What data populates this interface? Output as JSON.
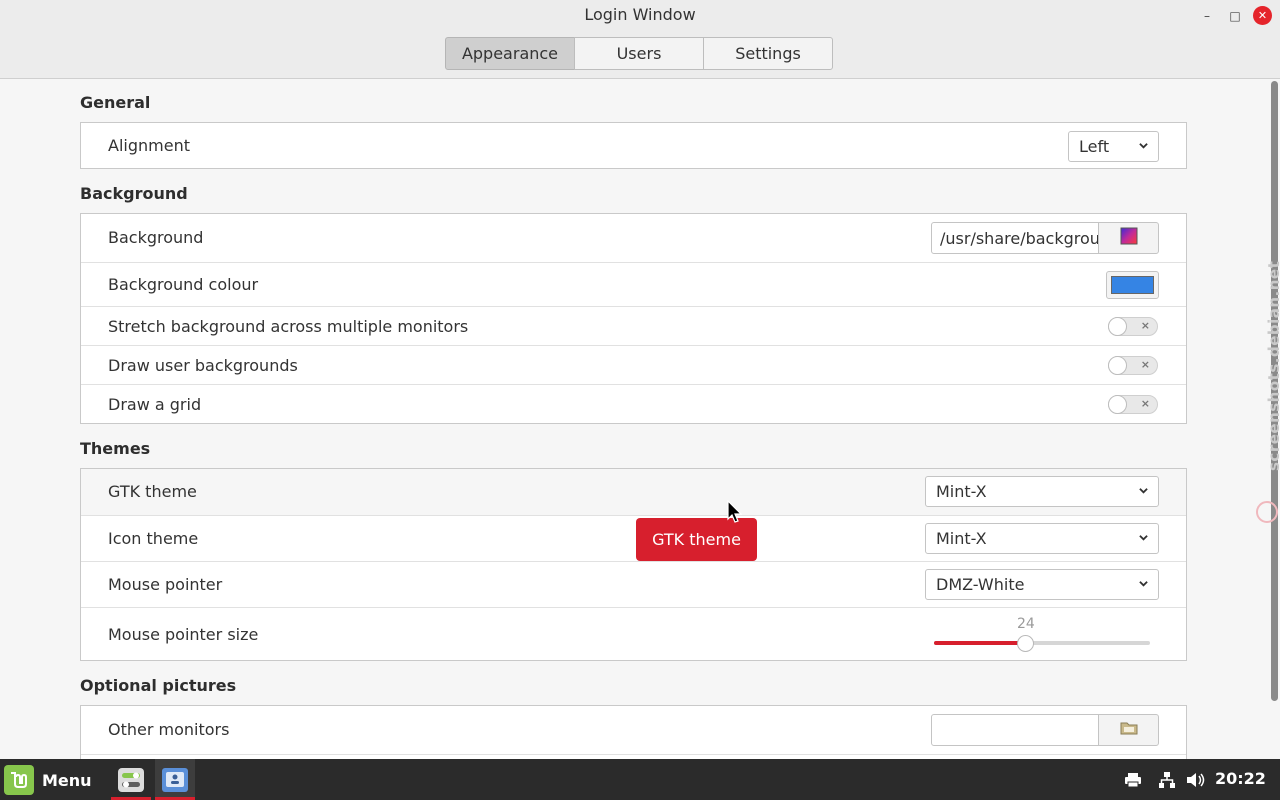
{
  "window": {
    "title": "Login Window",
    "minimize_glyph": "–",
    "maximize_glyph": "□",
    "close_glyph": "✕"
  },
  "tabs": [
    {
      "label": "Appearance",
      "active": true
    },
    {
      "label": "Users",
      "active": false
    },
    {
      "label": "Settings",
      "active": false
    }
  ],
  "sections": {
    "general": {
      "title": "General",
      "alignment": {
        "label": "Alignment",
        "value": "Left"
      }
    },
    "background": {
      "title": "Background",
      "background": {
        "label": "Background",
        "path": "/usr/share/backgrounds/",
        "button_icon": "image-icon"
      },
      "colour": {
        "label": "Background colour",
        "value": "#3584e4"
      },
      "stretch": {
        "label": "Stretch background across multiple monitors",
        "on": false
      },
      "user_backgrounds": {
        "label": "Draw user backgrounds",
        "on": false
      },
      "grid": {
        "label": "Draw a grid",
        "on": false
      }
    },
    "themes": {
      "title": "Themes",
      "gtk_theme": {
        "label": "GTK theme",
        "value": "Mint-X"
      },
      "icon_theme": {
        "label": "Icon theme",
        "value": "Mint-X"
      },
      "mouse_pointer": {
        "label": "Mouse pointer",
        "value": "DMZ-White"
      },
      "pointer_size": {
        "label": "Mouse pointer size",
        "value": "24",
        "fraction": 0.42
      }
    },
    "optional": {
      "title": "Optional pictures",
      "other_monitors": {
        "label": "Other monitors",
        "value": "",
        "button_icon": "folder-icon"
      }
    }
  },
  "tooltip": {
    "text": "GTK theme"
  },
  "watermark": "screenshots.debian.net",
  "taskbar": {
    "menu_label": "Menu",
    "clock": "20:22",
    "tray_icons": [
      "printer-icon",
      "network-icon",
      "volume-icon"
    ]
  },
  "colors": {
    "accent": "#d71f2d",
    "close": "#e5242b",
    "swatch": "#3584e4",
    "mint": "#87c64c"
  }
}
